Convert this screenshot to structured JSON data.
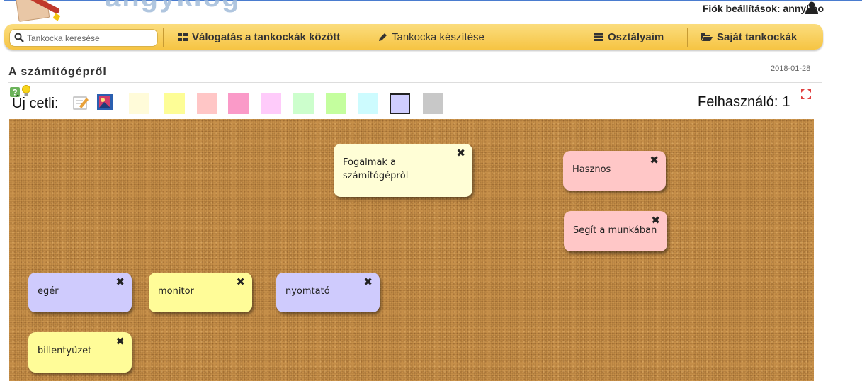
{
  "header": {
    "logo_text": "angyklog",
    "account_label": "Fiók beállítások: annykoo"
  },
  "nav": {
    "search_placeholder": "Tankocka keresése",
    "items": [
      {
        "label": "Válogatás a tankockák között",
        "icon": "grid-icon"
      },
      {
        "label": "Tankocka készítése",
        "icon": "pencil-icon"
      },
      {
        "label": "Osztályaim",
        "icon": "list-icon"
      },
      {
        "label": "Saját tankockák",
        "icon": "folder-open-icon"
      }
    ]
  },
  "page": {
    "title": "A számítógépről",
    "date": "2018-01-28"
  },
  "toolbar": {
    "new_note_label": "Új cetli:",
    "user_label": "Felhasználó:",
    "user_count": "1",
    "swatches": [
      "#fffbd9",
      "#fdfd96",
      "#ffc6c6",
      "#fa9ac8",
      "#fecbfa",
      "#ccfecc",
      "#c4fe9e",
      "#cdfbfe",
      "#cfcdfe",
      "#c8c8c8"
    ],
    "selected_swatch": 8
  },
  "notes": [
    {
      "text": "Fogalmak a számítógépről",
      "color": "#fffed6"
    },
    {
      "text": "Hasznos",
      "color": "#ffc7c7"
    },
    {
      "text": "Segít a munkában",
      "color": "#ffc7c7"
    },
    {
      "text": "egér",
      "color": "#cfcbfd"
    },
    {
      "text": "monitor",
      "color": "#fffc98"
    },
    {
      "text": "nyomtató",
      "color": "#cfcbfd"
    },
    {
      "text": "billentyűzet",
      "color": "#fffc98"
    }
  ],
  "close_glyph": "✖"
}
